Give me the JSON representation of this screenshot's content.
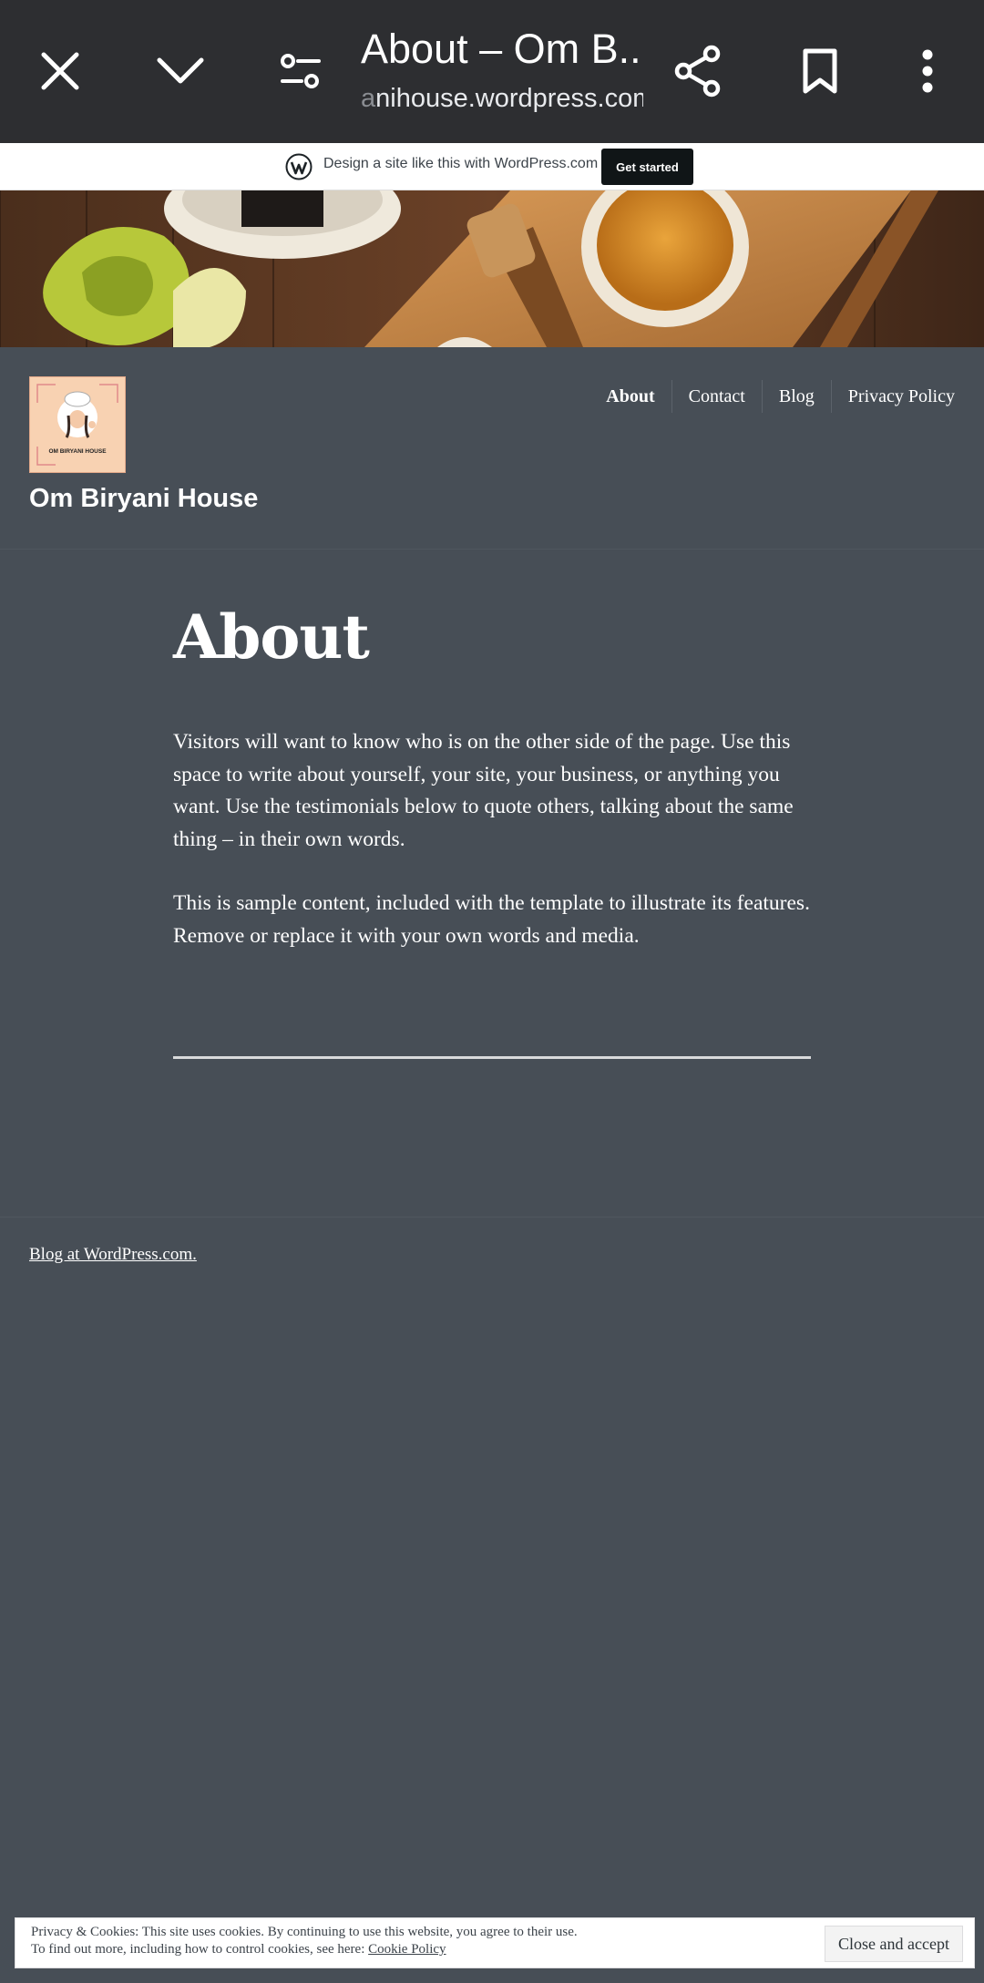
{
  "browser": {
    "title": "About – Om B...",
    "url_faded": "a",
    "url": "nihouse.wordpress.com",
    "icons": [
      "close-icon",
      "chevron-down-icon",
      "tune-icon",
      "share-icon",
      "bookmark-icon",
      "more-vert-icon"
    ]
  },
  "wp_banner": {
    "text": "Design a site like this with WordPress.com",
    "button": "Get started"
  },
  "site": {
    "logo_text": "OM BIRYANI HOUSE",
    "title": "Om Biryani House",
    "nav": [
      "About",
      "Contact",
      "Blog",
      "Privacy Policy"
    ],
    "active_nav": "About"
  },
  "page": {
    "title": "About",
    "paragraphs": [
      "Visitors will want to know who is on the other side of the page. Use this space to write about yourself, your site, your business, or any­thing you want. Use the testimonials below to quote others, talking about the same thing – in their own words.",
      "This is sample content, included with the template to illustrate its features. Remove or replace it with your own words and media."
    ]
  },
  "footer": {
    "link": "Blog at WordPress.com."
  },
  "cookie": {
    "line1": "Privacy & Cookies: This site uses cookies. By continuing to use this website, you agree to their use.",
    "line2": "To find out more, including how to control cookies, see here: ",
    "link": "Cookie Policy",
    "button": "Close and accept"
  },
  "colors": {
    "background": "#474e56",
    "browser_bar": "#2d2e31",
    "banner_button": "#101517"
  }
}
